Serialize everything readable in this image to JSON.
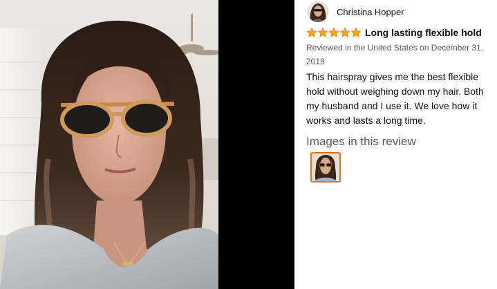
{
  "review": {
    "reviewer_name": "Christina Hopper",
    "rating": 5,
    "title": "Long lasting flexible hold",
    "meta": "Reviewed in the United States on December 31, 2019",
    "body": "This hairspray gives me the best flexible hold without weighing down my hair. Both my husband and I use it. We love how it works and lasts a long time.",
    "images_heading": "Images in this review"
  },
  "colors": {
    "star": "#ffa41c",
    "thumb_border": "#e77600",
    "letterbox": "#000000"
  },
  "icons": [
    "star-icon"
  ]
}
